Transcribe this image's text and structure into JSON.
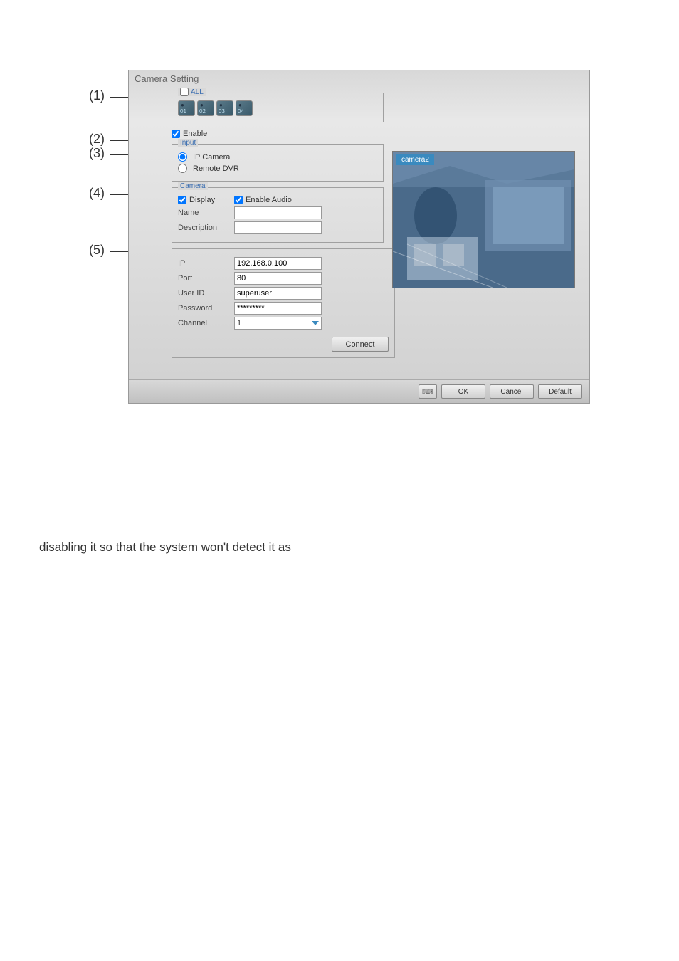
{
  "callouts": [
    "(1)",
    "(2)",
    "(3)",
    "(4)",
    "(5)"
  ],
  "dialog_title": "Camera Setting",
  "all": {
    "label": "ALL",
    "cameras": [
      "01",
      "02",
      "03",
      "04"
    ]
  },
  "enable_label": "Enable",
  "input_group": {
    "legend": "Input",
    "ip_camera_label": "IP Camera",
    "remote_dvr_label": "Remote DVR"
  },
  "camera_group": {
    "legend": "Camera",
    "display_label": "Display",
    "enable_audio_label": "Enable Audio",
    "name_label": "Name",
    "name_value": "",
    "description_label": "Description",
    "description_value": ""
  },
  "connection": {
    "ip_label": "IP",
    "ip_value": "192.168.0.100",
    "port_label": "Port",
    "port_value": "80",
    "user_id_label": "User ID",
    "user_id_value": "superuser",
    "password_label": "Password",
    "password_value": "*********",
    "channel_label": "Channel",
    "channel_value": "1",
    "connect_button": "Connect"
  },
  "preview_label": "camera2",
  "footer": {
    "ok": "OK",
    "cancel": "Cancel",
    "default": "Default"
  },
  "below_paragraph": "disabling it so that the system won't detect it as"
}
